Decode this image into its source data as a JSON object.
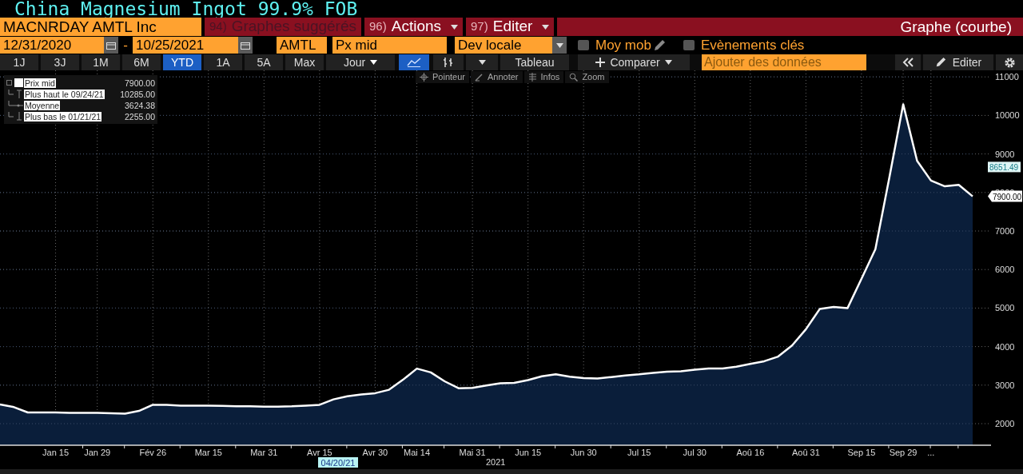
{
  "title": "China Magnesium Ingot 99.9% FOB",
  "header": {
    "security": "MACNRDAY AMTL Inc",
    "menus": [
      {
        "number": "94)",
        "label": "Graphes suggérés",
        "disabled": true,
        "dropdown": false
      },
      {
        "number": "96)",
        "label": "Actions",
        "disabled": false,
        "dropdown": true
      },
      {
        "number": "97)",
        "label": "Editer",
        "disabled": false,
        "dropdown": true
      }
    ],
    "view_title": "Graphe (courbe)"
  },
  "settings": {
    "start_date": "12/31/2020",
    "separator": "-",
    "end_date": "10/25/2021",
    "source": "AMTL",
    "field": "Px mid",
    "currency": "Dev locale",
    "options": [
      {
        "label": "Moy mob",
        "checked": false,
        "editable": true
      },
      {
        "label": "Evènements clés",
        "checked": false,
        "editable": false
      }
    ]
  },
  "toolbar": {
    "periods": [
      {
        "label": "1J",
        "selected": false
      },
      {
        "label": "3J",
        "selected": false
      },
      {
        "label": "1M",
        "selected": false
      },
      {
        "label": "6M",
        "selected": false
      },
      {
        "label": "YTD",
        "selected": true
      },
      {
        "label": "1A",
        "selected": false
      },
      {
        "label": "5A",
        "selected": false
      },
      {
        "label": "Max",
        "selected": false
      }
    ],
    "frequency": "Jour",
    "chart_types": [
      {
        "kind": "line",
        "selected": true
      },
      {
        "kind": "bars",
        "selected": false
      }
    ],
    "table": "Tableau",
    "compare": "Comparer",
    "add_data": {
      "placeholder": "Ajouter des données"
    },
    "edit": "Editer"
  },
  "chart_tools": [
    {
      "label": "Pointeur",
      "kind": "crosshair"
    },
    {
      "label": "Annoter",
      "kind": "pen"
    },
    {
      "label": "Infos",
      "kind": "list"
    },
    {
      "label": "Zoom",
      "kind": "search"
    }
  ],
  "legend": [
    {
      "value": "7900.00",
      "kind": "series"
    },
    {
      "label": "Plus haut le 09/24/21",
      "value": "10285.00",
      "kind": "high"
    },
    {
      "label": "Moyenne",
      "value": "3624.38",
      "kind": "average"
    },
    {
      "label": "Plus bas le 01/21/21",
      "value": "2255.00",
      "kind": "low"
    }
  ],
  "chart": {
    "cursor_date": "04/20/21",
    "year": "2021",
    "value_tags": [
      {
        "text": "8651.49",
        "kind": "tag"
      },
      {
        "text": "7900.00",
        "kind": "last"
      }
    ],
    "chart_data": {
      "type": "area",
      "grid": true,
      "ylim": [
        1440,
        11170
      ],
      "categories": [
        null,
        null,
        null,
        null,
        "Jan 15",
        null,
        null,
        "Jan 29",
        null,
        null,
        null,
        "Fév 26",
        null,
        null,
        null,
        "Mar 15",
        null,
        null,
        null,
        "Mar 31",
        null,
        null,
        null,
        "Avr 15",
        null,
        null,
        null,
        "Avr 30",
        null,
        null,
        "Mai 14",
        null,
        null,
        null,
        "Mai 31",
        null,
        null,
        null,
        "Jun 15",
        null,
        null,
        null,
        "Jun 30",
        null,
        null,
        null,
        "Jul 15",
        null,
        null,
        null,
        "Jul 30",
        null,
        null,
        null,
        "Aoû 16",
        null,
        null,
        null,
        "Aoû 31",
        null,
        null,
        null,
        "Sep 15",
        null,
        null,
        "Sep 29",
        null,
        "...",
        null,
        null,
        null
      ],
      "series": [
        {
          "name": "Prix mid",
          "color": "#ffffff",
          "values": [
            2500,
            2430,
            2290,
            2290,
            2290,
            2280,
            2280,
            2280,
            2270,
            2260,
            2330,
            2490,
            2490,
            2470,
            2470,
            2470,
            2460,
            2450,
            2450,
            2440,
            2440,
            2450,
            2470,
            2490,
            2630,
            2710,
            2760,
            2790,
            2880,
            3140,
            3430,
            3330,
            3100,
            2920,
            2930,
            2990,
            3050,
            3060,
            3130,
            3230,
            3280,
            3220,
            3180,
            3170,
            3210,
            3250,
            3280,
            3320,
            3350,
            3360,
            3400,
            3430,
            3430,
            3480,
            3550,
            3620,
            3740,
            4030,
            4450,
            4980,
            5030,
            5000,
            5760,
            6530,
            8380,
            10290,
            8820,
            8310,
            8160,
            8200,
            7900
          ]
        }
      ],
      "yticks": [
        2000,
        3000,
        4000,
        5000,
        6000,
        7000,
        8000,
        9000,
        10000,
        11000
      ]
    }
  }
}
